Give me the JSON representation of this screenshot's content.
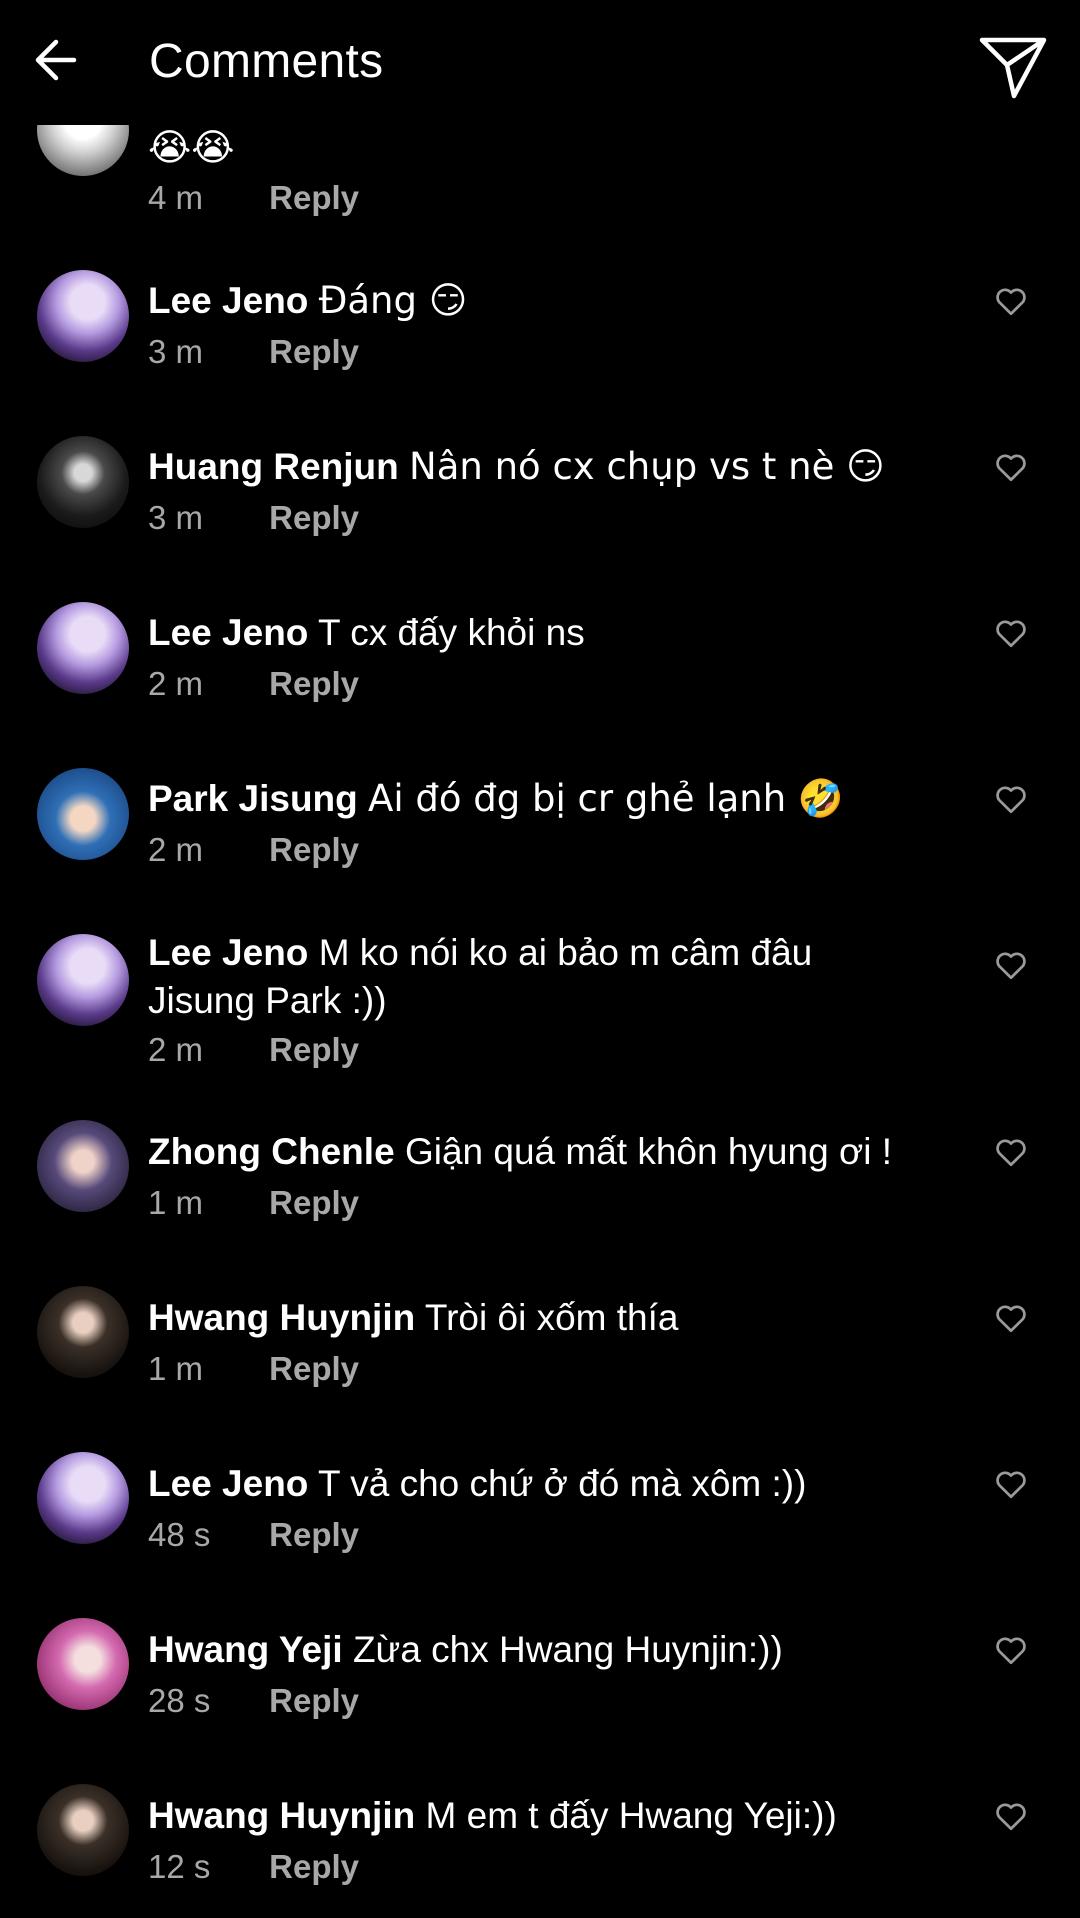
{
  "header": {
    "title": "Comments",
    "back_icon": "back-arrow-icon",
    "send_icon": "send-icon"
  },
  "colors": {
    "background": "#000000",
    "text": "#ffffff",
    "muted": "#a8a8a8"
  },
  "reply_label": "Reply",
  "partial_comment": {
    "text": "😭😭",
    "time": "4 m"
  },
  "comments": [
    {
      "author": "Lee Jeno",
      "text": "Đáng 😏",
      "time": "3 m"
    },
    {
      "author": "Huang Renjun",
      "text": "Nân nó cx chụp vs t nè 😏",
      "time": "3 m"
    },
    {
      "author": "Lee Jeno",
      "text": "T cx đấy khỏi ns",
      "time": "2 m"
    },
    {
      "author": "Park Jisung",
      "text": "Ai đó đg bị cr ghẻ lạnh 🤣",
      "time": "2 m"
    },
    {
      "author": "Lee Jeno",
      "text": "M ko nói ko ai bảo m câm đâu Jisung Park :))",
      "time": "2 m"
    },
    {
      "author": "Zhong Chenle",
      "text": "Giận quá mất khôn hyung ơi !",
      "time": "1 m"
    },
    {
      "author": "Hwang Huynjin",
      "text": "Tròi ôi xốm thía",
      "time": "1 m"
    },
    {
      "author": "Lee Jeno",
      "text": "T vả cho chứ ở đó mà xôm :))",
      "time": "48 s"
    },
    {
      "author": "Hwang Yeji",
      "text": "Zừa chx Hwang Huynjin:))",
      "time": "28 s"
    },
    {
      "author": "Hwang Huynjin",
      "text": "M em t đấy Hwang Yeji:))",
      "time": "12 s"
    }
  ]
}
